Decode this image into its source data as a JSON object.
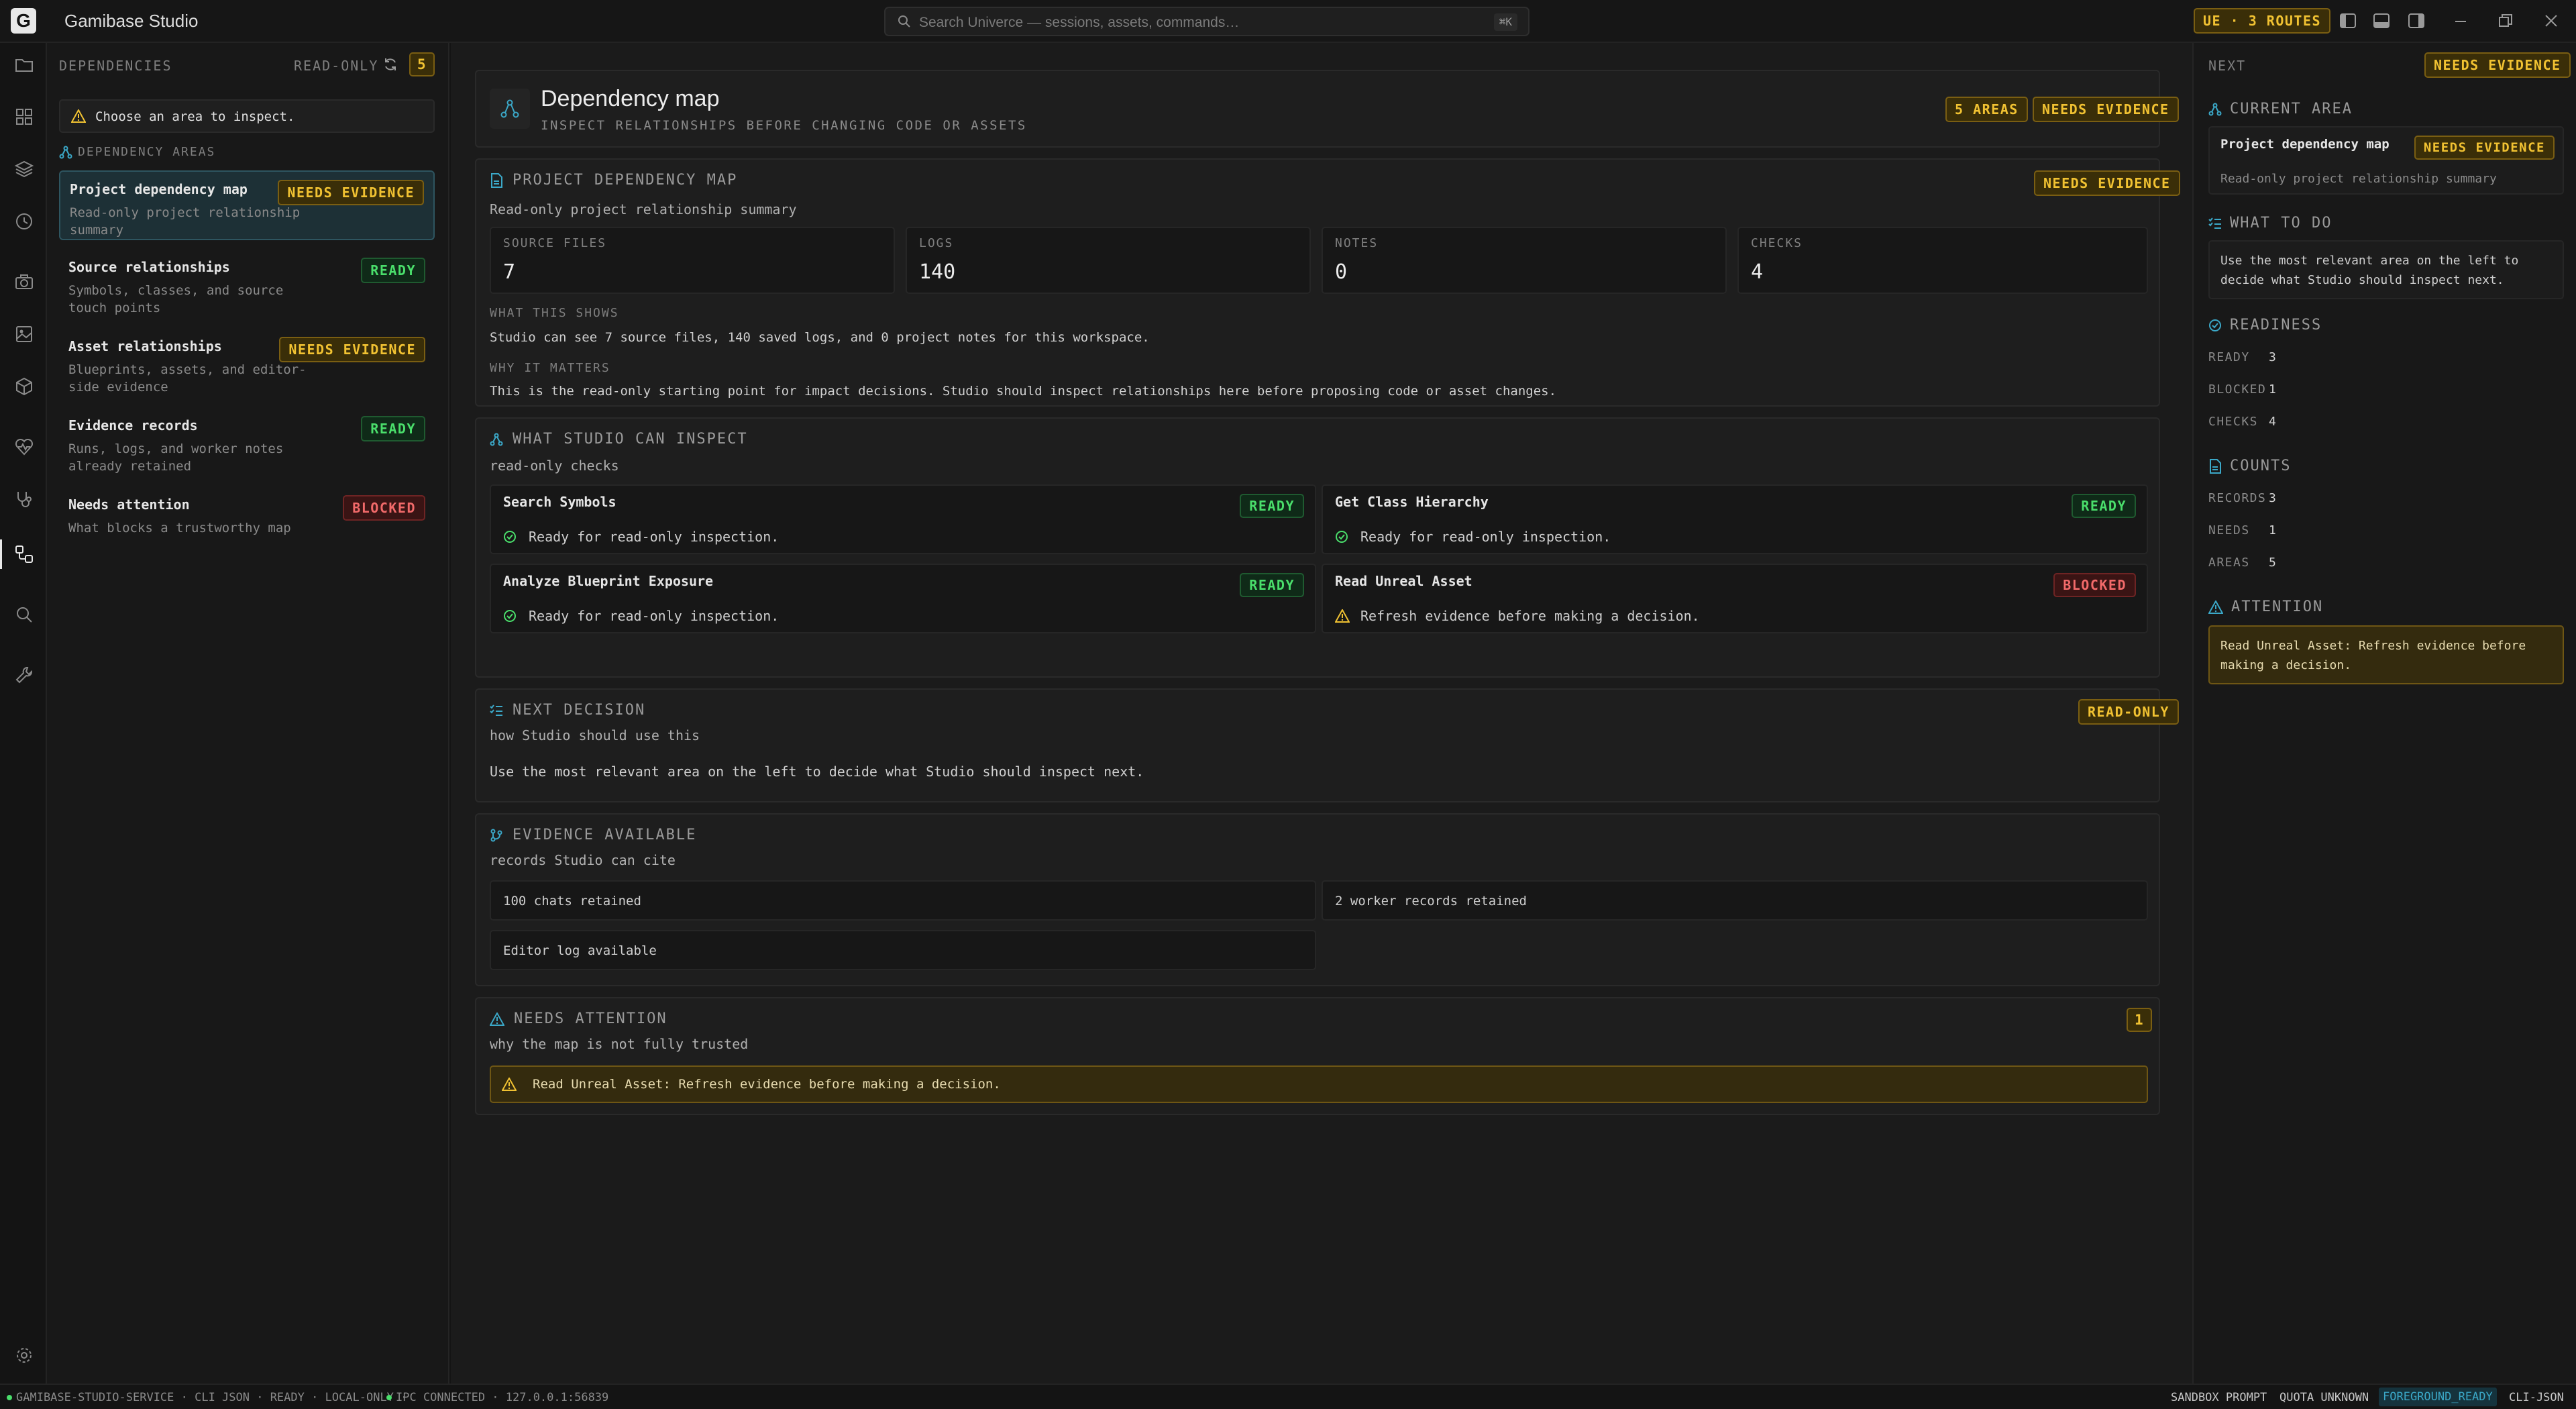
{
  "app": {
    "title": "Gamibase Studio",
    "logo_letter": "G"
  },
  "search": {
    "placeholder": "Search Univerce — sessions, assets, commands…",
    "shortcut": "⌘K"
  },
  "titlebar": {
    "routes_badge": "UE · 3 ROUTES"
  },
  "colors": {
    "accent": "#3ba8c8",
    "amber": "#f1c232",
    "green": "#4ade6b",
    "red": "#f26a6a"
  },
  "rail": {
    "items": [
      "folder-icon",
      "dashboard-icon",
      "layers-icon",
      "history-icon",
      "camera-icon",
      "image-icon",
      "cube-icon",
      "health-icon",
      "stethoscope-icon",
      "dependency-icon",
      "search-icon",
      "wrench-icon",
      "settings-icon"
    ],
    "active": "dependency-icon"
  },
  "sidebar": {
    "title": "DEPENDENCIES",
    "mode": "READ-ONLY",
    "count": "5",
    "notice": "Choose an area to inspect.",
    "section_label": "DEPENDENCY AREAS",
    "items": [
      {
        "title": "Project dependency map",
        "desc": "Read-only project relationship summary",
        "status": "NEEDS EVIDENCE",
        "tone": "amber"
      },
      {
        "title": "Source relationships",
        "desc": "Symbols, classes, and source touch points",
        "status": "READY",
        "tone": "green"
      },
      {
        "title": "Asset relationships",
        "desc": "Blueprints, assets, and editor-side evidence",
        "status": "NEEDS EVIDENCE",
        "tone": "amber"
      },
      {
        "title": "Evidence records",
        "desc": "Runs, logs, and worker notes already retained",
        "status": "READY",
        "tone": "green"
      },
      {
        "title": "Needs attention",
        "desc": "What blocks a trustworthy map",
        "status": "BLOCKED",
        "tone": "red"
      }
    ]
  },
  "header": {
    "title": "Dependency map",
    "subtitle": "INSPECT RELATIONSHIPS BEFORE CHANGING CODE OR ASSETS",
    "badge_areas": "5 AREAS",
    "badge_status": "NEEDS EVIDENCE"
  },
  "project_map": {
    "title": "PROJECT DEPENDENCY MAP",
    "subtitle": "Read-only project relationship summary",
    "badge": "NEEDS EVIDENCE",
    "stats": [
      {
        "label": "SOURCE FILES",
        "value": "7"
      },
      {
        "label": "LOGS",
        "value": "140"
      },
      {
        "label": "NOTES",
        "value": "0"
      },
      {
        "label": "CHECKS",
        "value": "4"
      }
    ],
    "what_label": "WHAT THIS SHOWS",
    "what_text": "Studio can see 7 source files, 140 saved logs, and 0 project notes for this workspace.",
    "why_label": "WHY IT MATTERS",
    "why_text": "This is the read-only starting point for impact decisions. Studio should inspect relationships here before proposing code or asset changes."
  },
  "inspect": {
    "title": "WHAT STUDIO CAN INSPECT",
    "subtitle": "read-only checks",
    "checks": [
      {
        "name": "Search Symbols",
        "status": "READY",
        "note": "Ready for read-only inspection.",
        "tone": "green"
      },
      {
        "name": "Get Class Hierarchy",
        "status": "READY",
        "note": "Ready for read-only inspection.",
        "tone": "green"
      },
      {
        "name": "Analyze Blueprint Exposure",
        "status": "READY",
        "note": "Ready for read-only inspection.",
        "tone": "green"
      },
      {
        "name": "Read Unreal Asset",
        "status": "BLOCKED",
        "note": "Refresh evidence before making a decision.",
        "tone": "red"
      }
    ]
  },
  "next_decision": {
    "title": "NEXT DECISION",
    "subtitle": "how Studio should use this",
    "badge": "READ-ONLY",
    "text": "Use the most relevant area on the left to decide what Studio should inspect next."
  },
  "evidence": {
    "title": "EVIDENCE AVAILABLE",
    "subtitle": "records Studio can cite",
    "items": [
      "100 chats retained",
      "2 worker records retained",
      "Editor log available"
    ]
  },
  "attention": {
    "title": "NEEDS ATTENTION",
    "subtitle": "why the map is not fully trusted",
    "count": "1",
    "message": "Read Unreal Asset: Refresh evidence before making a decision."
  },
  "right": {
    "title": "NEXT",
    "badge": "NEEDS EVIDENCE",
    "current_area_label": "CURRENT AREA",
    "current_area_name": "Project dependency map",
    "current_area_badge": "NEEDS EVIDENCE",
    "current_area_desc": "Read-only project relationship summary",
    "what_to_do_label": "WHAT TO DO",
    "what_to_do_text": "Use the most relevant area on the left to decide what Studio should inspect next.",
    "readiness_label": "READINESS",
    "readiness": [
      {
        "k": "READY",
        "v": "3"
      },
      {
        "k": "BLOCKED",
        "v": "1"
      },
      {
        "k": "CHECKS",
        "v": "4"
      }
    ],
    "counts_label": "COUNTS",
    "counts": [
      {
        "k": "RECORDS",
        "v": "3"
      },
      {
        "k": "NEEDS",
        "v": "1"
      },
      {
        "k": "AREAS",
        "v": "5"
      }
    ],
    "attention_label": "ATTENTION",
    "attention_text": "Read Unreal Asset: Refresh evidence before making a decision."
  },
  "statusbar": {
    "left": "GAMIBASE-STUDIO-SERVICE · CLI JSON · READY · LOCAL-ONLY ·",
    "ipc": "IPC CONNECTED · 127.0.0.1:56839",
    "right": [
      "SANDBOX PROMPT",
      "QUOTA UNKNOWN",
      "FOREGROUND_READY",
      "CLI-JSON"
    ]
  }
}
